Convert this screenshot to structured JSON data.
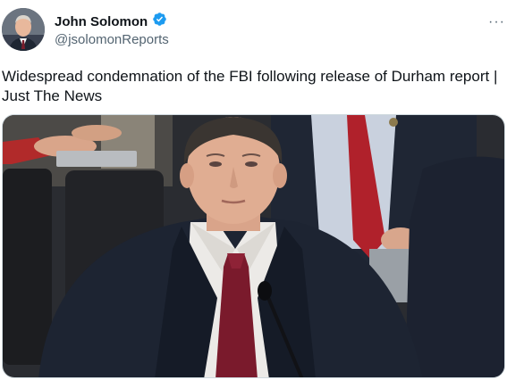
{
  "author": {
    "name": "John Solomon",
    "handle": "@jsolomonReports",
    "verified": true,
    "badge_color": "#1d9bf0",
    "avatar_icon": "avatar-photo"
  },
  "menu": {
    "more_label": "···",
    "icon": "more-horizontal-icon"
  },
  "tweet": {
    "text": "Widespread condemnation of the FBI following release of Durham report | Just The News"
  },
  "media": {
    "kind": "photo",
    "subject": "man in dark suit and red tie seated at hearing with microphone"
  },
  "colors": {
    "text_primary": "#0f1419",
    "text_secondary": "#536471",
    "border": "#cfd9de"
  }
}
